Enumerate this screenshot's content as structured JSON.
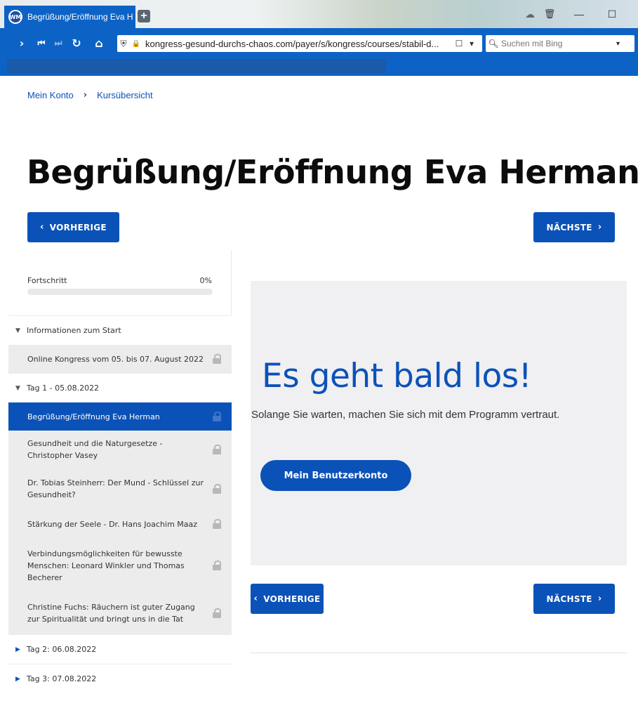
{
  "browser": {
    "tab_title": "Begrüßung/Eröffnung Eva H",
    "favicon_text": "WM",
    "new_tab_label": "+",
    "url": "kongress-gesund-durchs-chaos.com/payer/s/kongress/courses/stabil-d...",
    "search_placeholder": "Suchen mit Bing",
    "nav": {
      "back": "›",
      "first": "⏮",
      "last": "⏭",
      "reload": "↻",
      "home": "⌂"
    },
    "win": {
      "cloud": "☁",
      "trash": "🗑",
      "minimize": "—",
      "maximize": "☐"
    },
    "url_icons": {
      "shield": "⛨",
      "lock": "🔒",
      "bookmark": "☐",
      "dropdown": "▾"
    },
    "search_icon": "🔍︎",
    "search_dropdown": "▾"
  },
  "breadcrumb": {
    "items": [
      "Mein Konto",
      "Kursübersicht"
    ],
    "separator": "›"
  },
  "page_title": "Begrüßung/Eröffnung Eva Herman",
  "nav_buttons": {
    "prev_label": "VORHERIGE",
    "next_label": "NÄCHSTE",
    "prev_chev": "‹",
    "next_chev": "›"
  },
  "sidebar": {
    "progress_label": "Fortschritt",
    "progress_text": "0%",
    "progress_value": 0,
    "sections": [
      {
        "title": "Informationen zum Start",
        "expanded": true
      },
      {
        "title": "Tag 1 - 05.08.2022",
        "expanded": true
      },
      {
        "title": "Tag 2: 06.08.2022",
        "expanded": false
      },
      {
        "title": "Tag 3: 07.08.2022",
        "expanded": false
      }
    ],
    "items": [
      "Online Kongress vom 05. bis 07. August 2022",
      "Begrüßung/Eröffnung Eva Herman",
      "Gesundheit und die Naturgesetze - Christopher Vasey",
      "Dr. Tobias Steinherr: Der Mund - Schlüssel zur Gesundheit?",
      "Stärkung der Seele - Dr. Hans Joachim Maaz",
      "Verbindungsmöglichkeiten für bewusste Menschen: Leonard Winkler und Thomas Becherer",
      "Christine Fuchs: Räuchern ist guter Zugang zur Spiritualität und bringt uns in die Tat"
    ],
    "arrow_down": "▼",
    "arrow_right": "▶"
  },
  "content": {
    "hero": "Es geht bald los!",
    "subtitle": "Solange Sie warten, machen Sie sich mit dem Programm vertraut.",
    "cta_label": "Mein Benutzerkonto"
  },
  "colors": {
    "primary": "#0b52b8",
    "browser_blue": "#0d63c5",
    "panel_bg": "#f0eff1",
    "sidebar_item_bg": "#ececec"
  }
}
